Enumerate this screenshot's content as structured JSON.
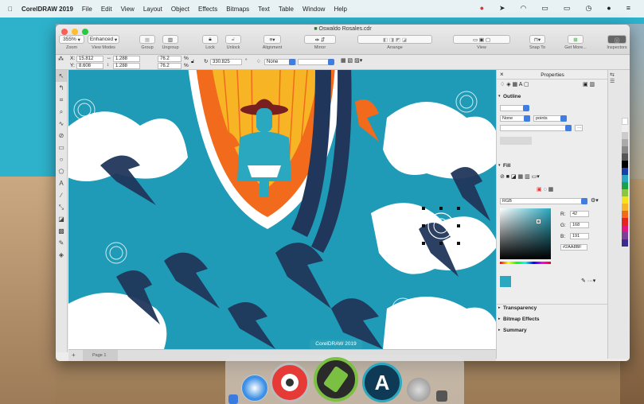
{
  "menubar": {
    "apple": "",
    "app": "CorelDRAW 2019",
    "items": [
      "File",
      "Edit",
      "View",
      "Layout",
      "Object",
      "Effects",
      "Bitmaps",
      "Text",
      "Table",
      "Window",
      "Help"
    ]
  },
  "window": {
    "title": "Oswaldo Rosales.cdr"
  },
  "toolbar": {
    "zoom": {
      "value": "355%",
      "label": "Zoom"
    },
    "view_modes": {
      "value": "Enhanced",
      "label": "View Modes"
    },
    "group": "Group",
    "ungroup": "Ungroup",
    "lock": "Lock",
    "unlock": "Unlock",
    "alignment": "Alignment",
    "mirror": "Mirror",
    "arrange": "Arrange",
    "view": "View",
    "snap_to": "Snap To",
    "get_more": "Get More...",
    "inspectors": "Inspectors"
  },
  "propbar": {
    "x_label": "X:",
    "x": "15.812",
    "y_label": "Y:",
    "y": "8.608",
    "w": "1.288",
    "h": "1.288",
    "sx": "76.2",
    "sy": "76.2",
    "pct": "%",
    "angle": "330.825",
    "deg": "°",
    "outline": "None"
  },
  "properties": {
    "title": "Properties",
    "outline_title": "Outline",
    "outline_width": "None",
    "outline_units": "points",
    "fill_title": "Fill",
    "color_model": "RGB",
    "r_label": "R:",
    "r": "42",
    "g_label": "G:",
    "g": "168",
    "b_label": "B:",
    "b": "191",
    "hex": "#2AA8BF",
    "transparency": "Transparency",
    "bitmap_effects": "Bitmap Effects",
    "summary": "Summary"
  },
  "pages": {
    "page1": "Page 1"
  },
  "tooltip": "CorelDRAW 2019",
  "colors": {
    "accent": "#2AA8BF",
    "orange": "#f26a1b",
    "yellow": "#f7b525",
    "navy": "#20365a"
  }
}
